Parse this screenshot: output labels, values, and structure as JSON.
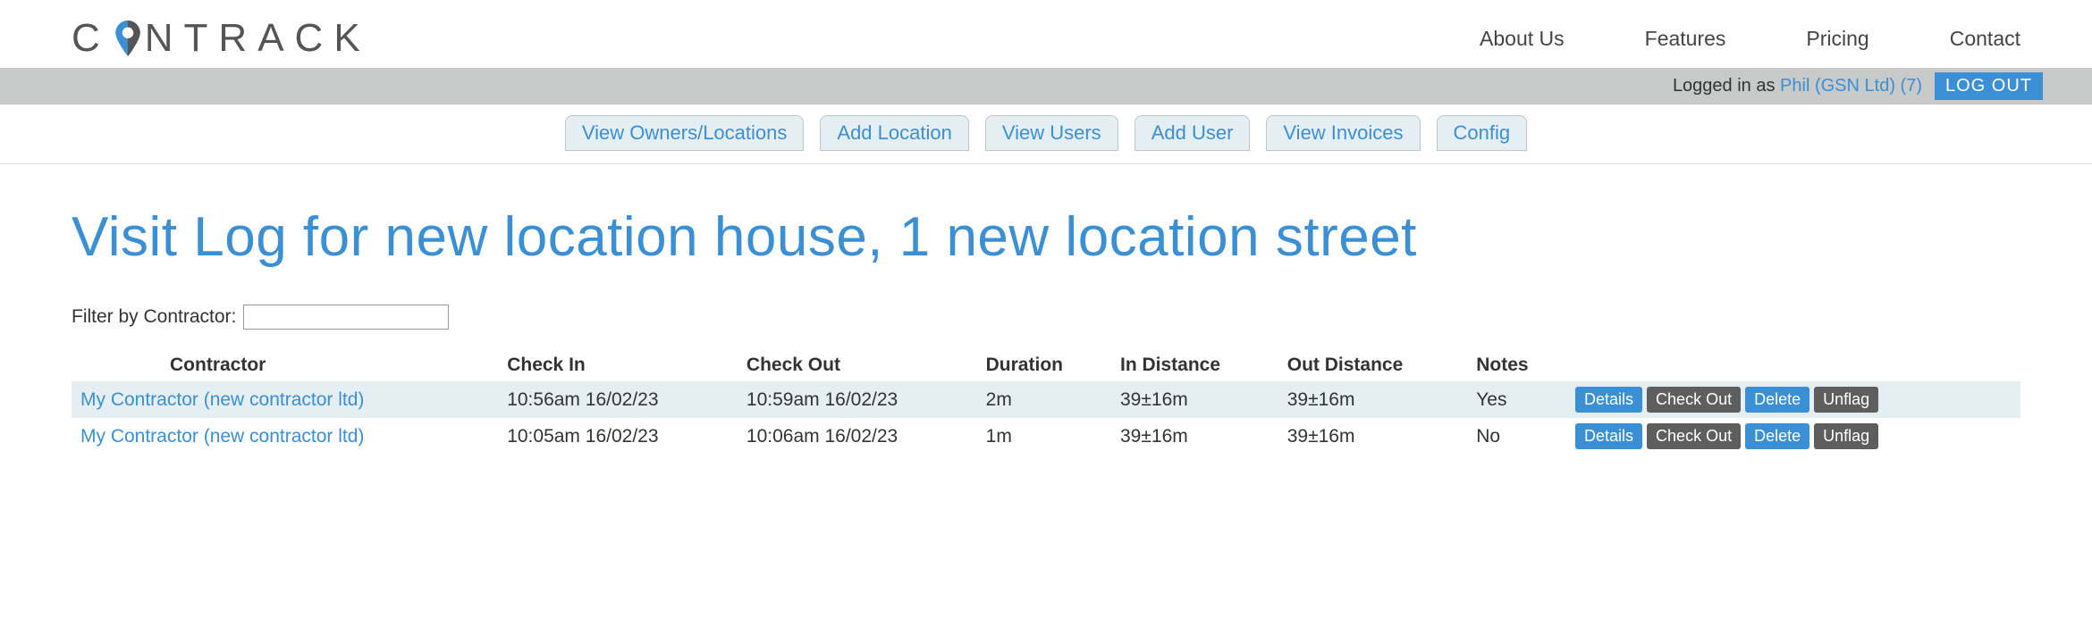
{
  "brand": {
    "pre": "C",
    "post": "NTRACK"
  },
  "nav": [
    "About Us",
    "Features",
    "Pricing",
    "Contact"
  ],
  "status": {
    "pre": "Logged in as ",
    "user": "Phil (GSN Ltd) (7)",
    "logout": "LOG OUT"
  },
  "tabs": [
    "View Owners/Locations",
    "Add Location",
    "View Users",
    "Add User",
    "View Invoices",
    "Config"
  ],
  "title": "Visit Log for new location house, 1 new location street",
  "filter_label": "Filter by Contractor:",
  "table": {
    "headers": [
      "Contractor",
      "Check In",
      "Check Out",
      "Duration",
      "In Distance",
      "Out Distance",
      "Notes"
    ],
    "rows": [
      {
        "contractor": "My Contractor (new contractor ltd)",
        "checkin": "10:56am 16/02/23",
        "checkout": "10:59am 16/02/23",
        "duration": "2m",
        "indist": "39±16m",
        "outdist": "39±16m",
        "notes": "Yes"
      },
      {
        "contractor": "My Contractor (new contractor ltd)",
        "checkin": "10:05am 16/02/23",
        "checkout": "10:06am 16/02/23",
        "duration": "1m",
        "indist": "39±16m",
        "outdist": "39±16m",
        "notes": "No"
      }
    ],
    "actions": {
      "details": "Details",
      "checkout": "Check Out",
      "delete": "Delete",
      "unflag": "Unflag"
    }
  }
}
